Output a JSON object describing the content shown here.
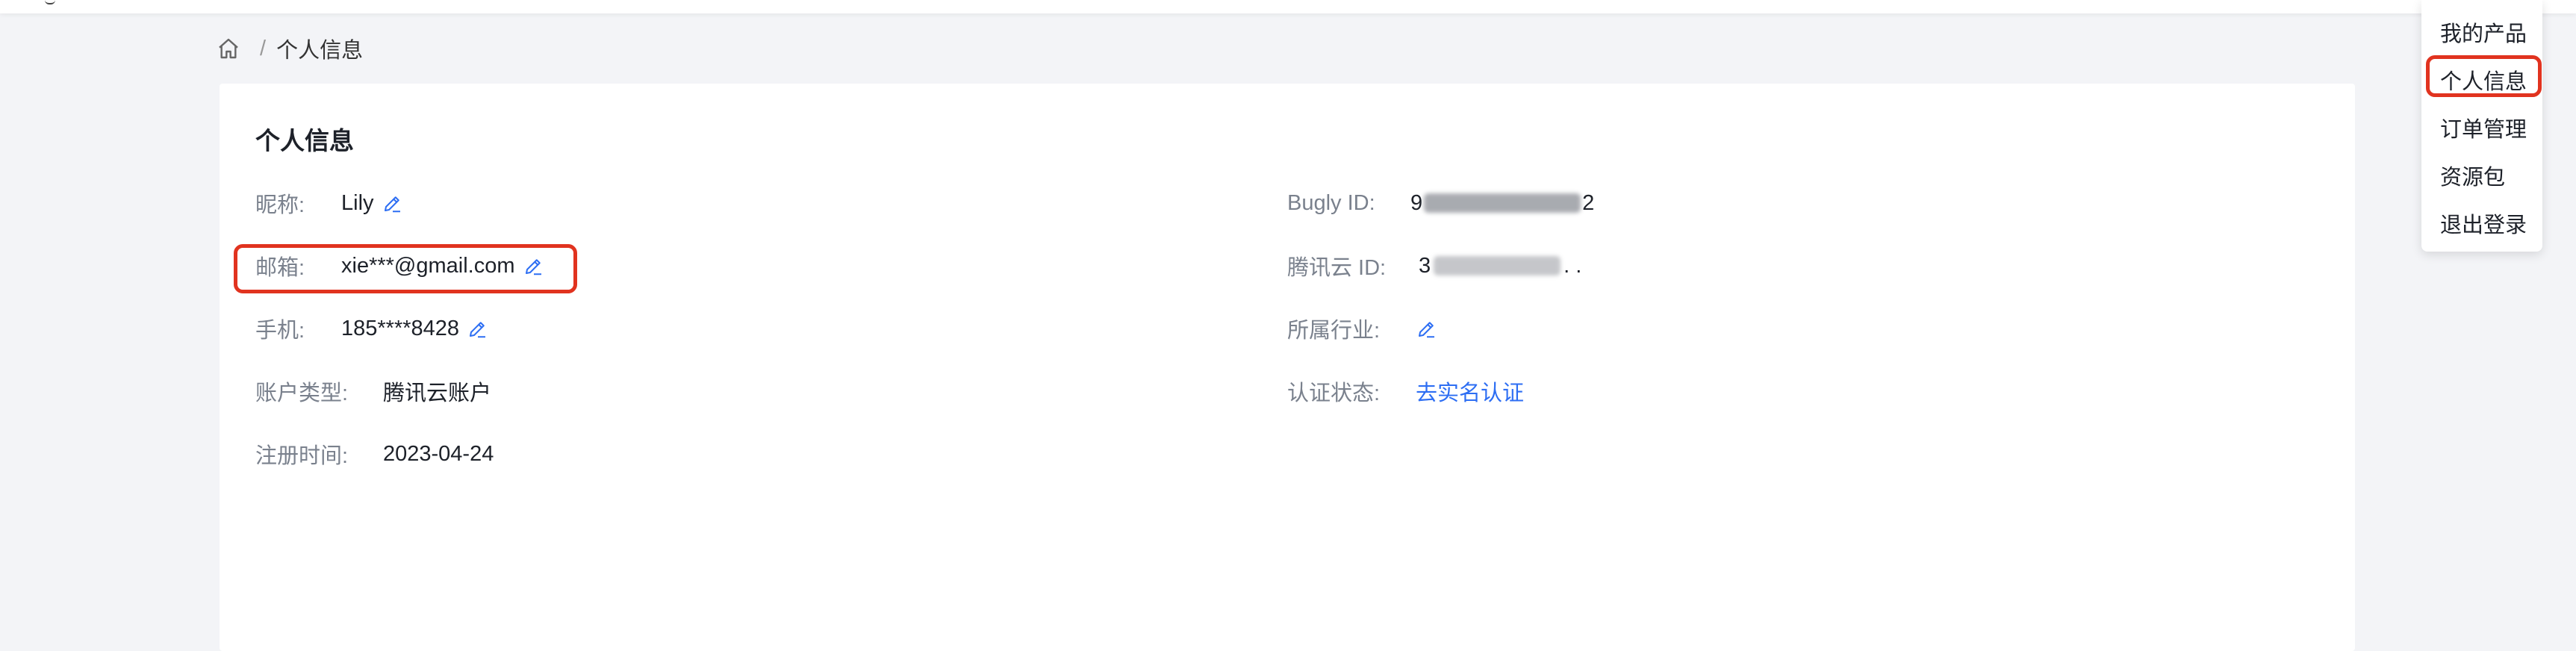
{
  "breadcrumb": {
    "home_icon": "home-icon",
    "separator": "/",
    "current": "个人信息"
  },
  "card": {
    "title": "个人信息"
  },
  "left_fields": {
    "nickname": {
      "label": "昵称:",
      "value": "Lily"
    },
    "email": {
      "label": "邮箱:",
      "value": "xie***@gmail.com"
    },
    "phone": {
      "label": "手机:",
      "value": "185****8428"
    },
    "account_type": {
      "label": "账户类型:",
      "value": "腾讯云账户"
    },
    "register_time": {
      "label": "注册时间:",
      "value": "2023-04-24"
    }
  },
  "right_fields": {
    "bugly_id": {
      "label": "Bugly ID:",
      "value_start": "9",
      "value_end": "2"
    },
    "tencent_cloud_id": {
      "label": "腾讯云 ID:",
      "value_start": "3",
      "value_end": ". ."
    },
    "industry": {
      "label": "所属行业:"
    },
    "verify_status": {
      "label": "认证状态:",
      "action": "去实名认证"
    }
  },
  "dropdown_menu": {
    "items": [
      "我的产品",
      "个人信息",
      "订单管理",
      "资源包",
      "退出登录"
    ],
    "highlighted_index": 1
  },
  "colors": {
    "highlight": "#e1331f",
    "link": "#2d6ef3",
    "label": "#7a818d"
  }
}
